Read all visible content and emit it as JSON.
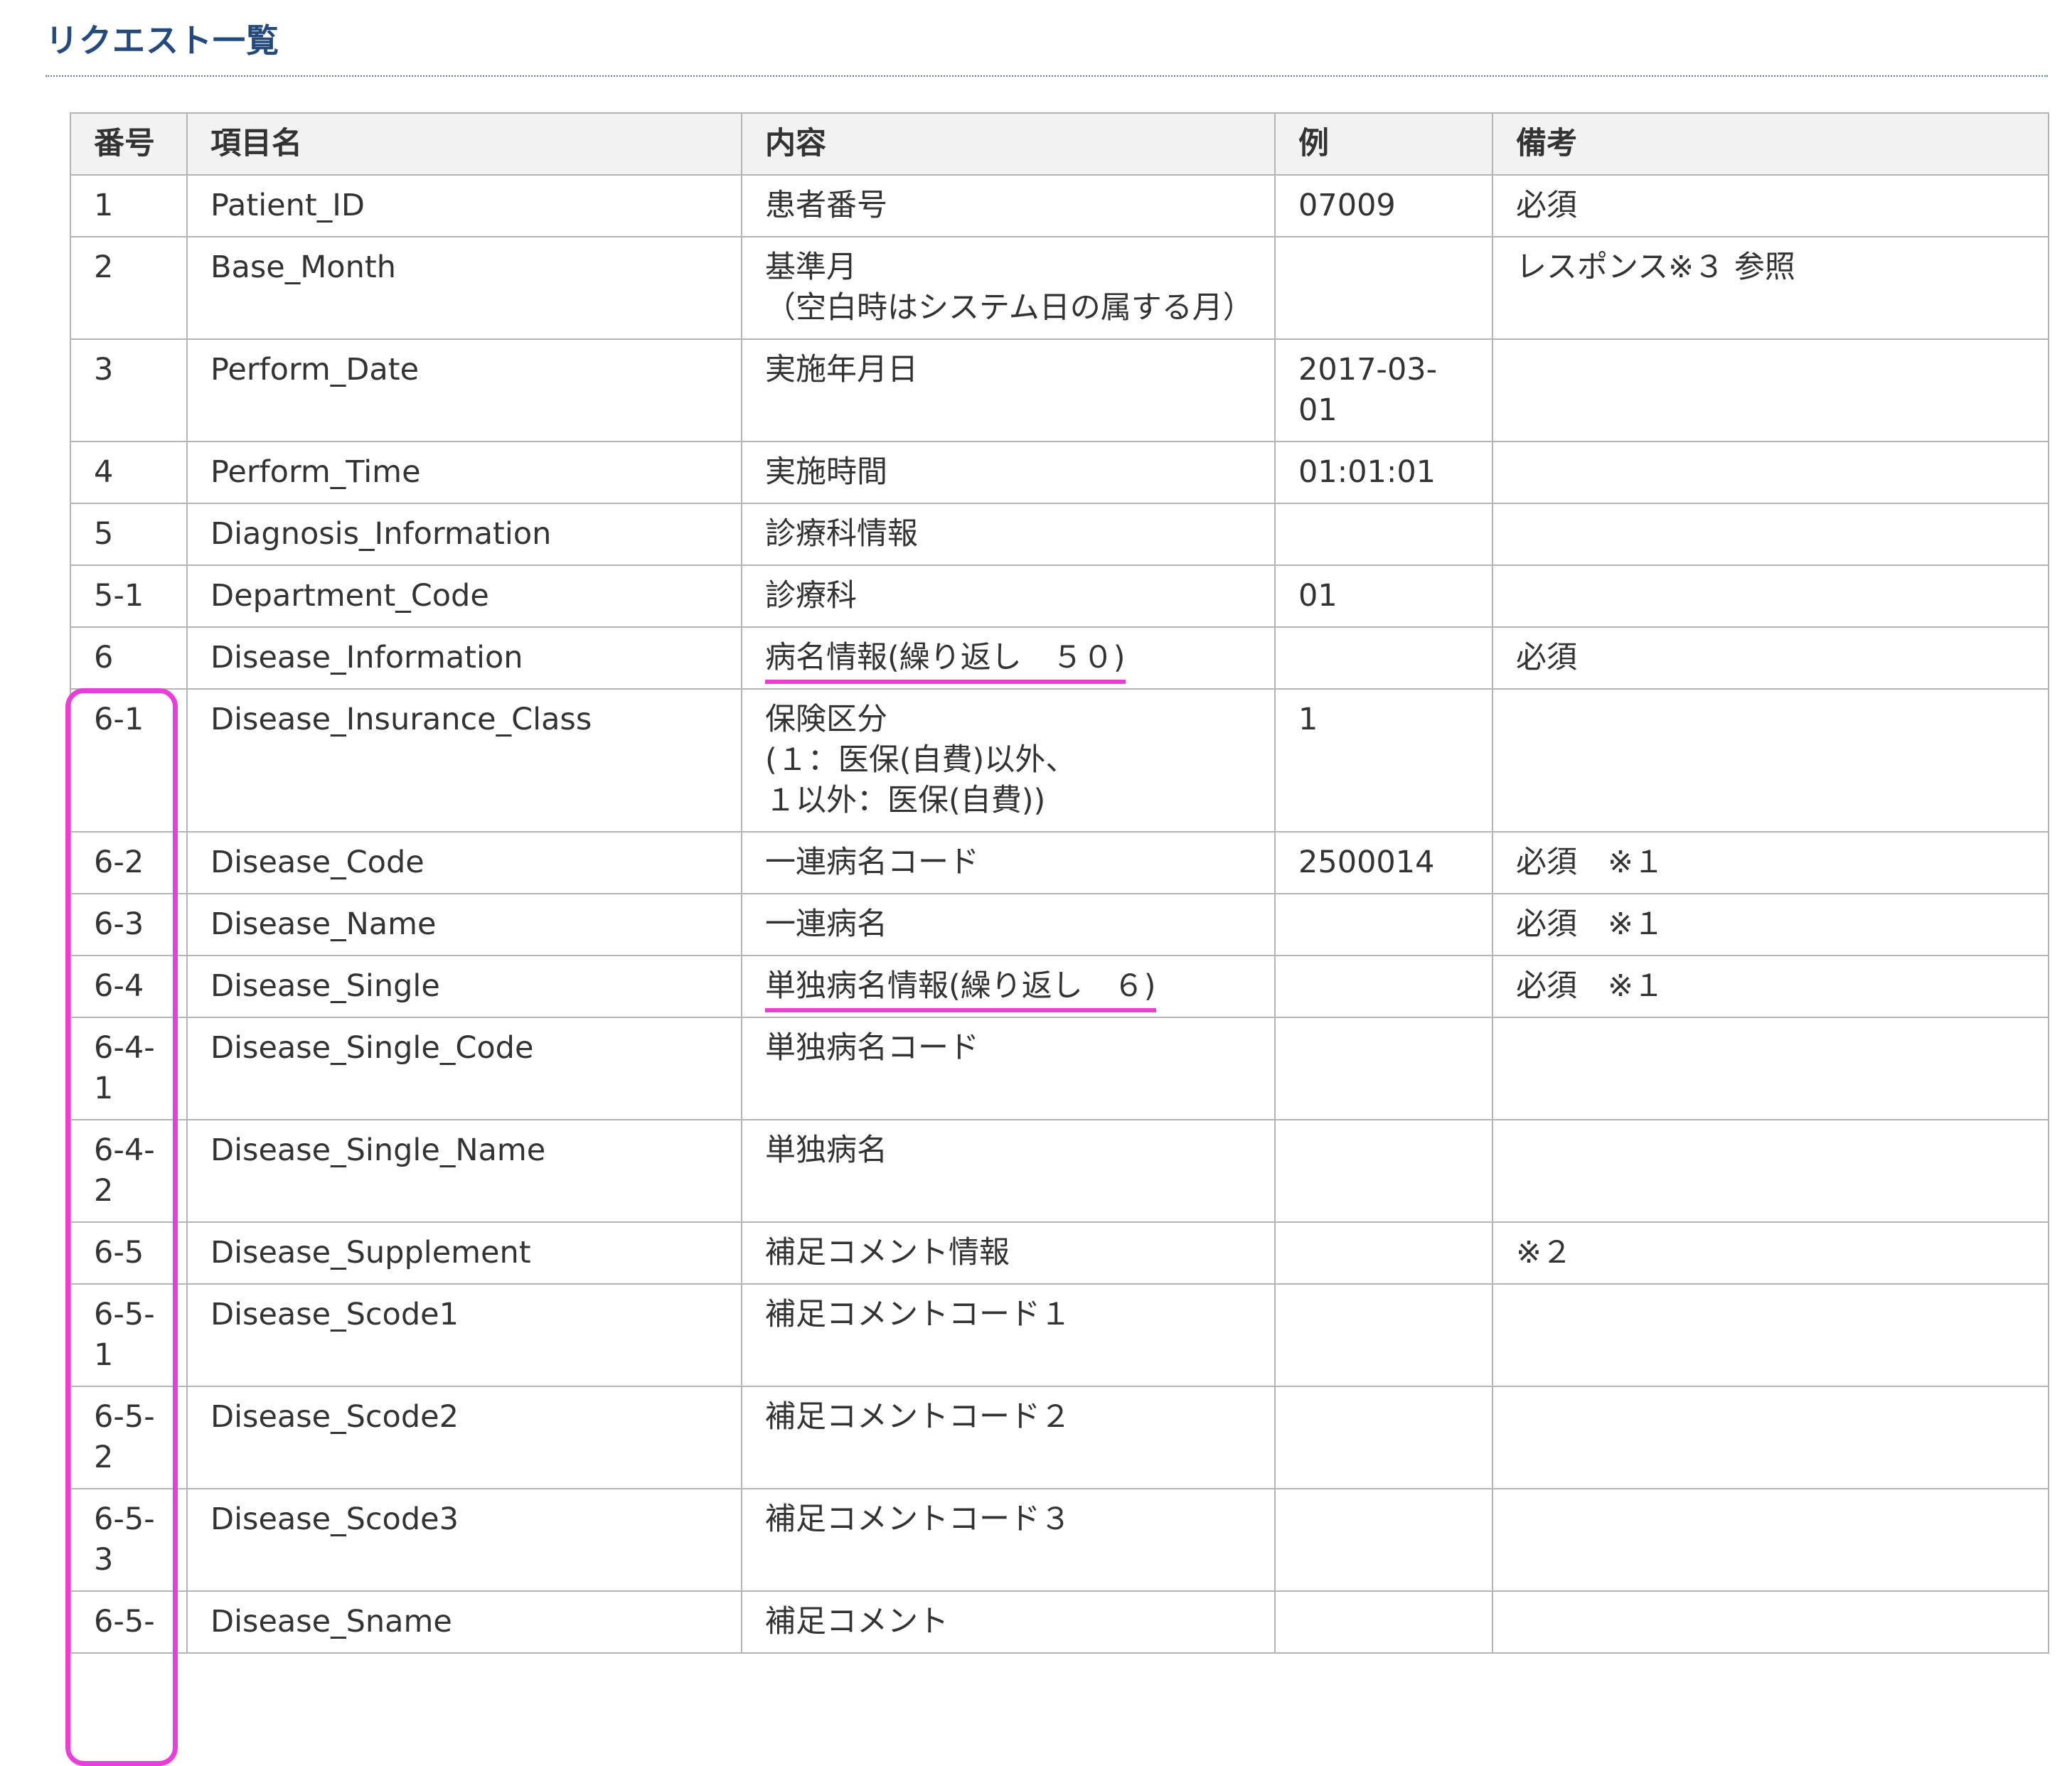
{
  "page": {
    "title": "リクエスト一覧"
  },
  "table": {
    "headers": {
      "no": "番号",
      "name": "項目名",
      "content": "内容",
      "example": "例",
      "note": "備考"
    },
    "rows": [
      {
        "no": "1",
        "name": "Patient_ID",
        "content": "患者番号",
        "example": "07009",
        "note": "必須"
      },
      {
        "no": "2",
        "name": "Base_Month",
        "content": "基準月\n（空白時はシステム日の属する月）",
        "example": "",
        "note": "レスポンス※３ 参照"
      },
      {
        "no": "3",
        "name": "Perform_Date",
        "content": "実施年月日",
        "example": "2017-03-01",
        "note": ""
      },
      {
        "no": "4",
        "name": "Perform_Time",
        "content": "実施時間",
        "example": "01:01:01",
        "note": ""
      },
      {
        "no": "5",
        "name": "Diagnosis_Information",
        "content": "診療科情報",
        "example": "",
        "note": ""
      },
      {
        "no": "5-1",
        "name": "Department_Code",
        "content": "診療科",
        "example": "01",
        "note": ""
      },
      {
        "no": "6",
        "name": "Disease_Information",
        "content": "病名情報(繰り返し　５０)",
        "example": "",
        "note": "必須",
        "underline": true
      },
      {
        "no": "6-1",
        "name": "Disease_Insurance_Class",
        "content": "保険区分\n(１：医保(自費)以外、\n１以外：医保(自費))",
        "example": "1",
        "note": ""
      },
      {
        "no": "6-2",
        "name": "Disease_Code",
        "content": "一連病名コード",
        "example": "2500014",
        "note": "必須　※１"
      },
      {
        "no": "6-3",
        "name": "Disease_Name",
        "content": "一連病名",
        "example": "",
        "note": "必須　※１"
      },
      {
        "no": "6-4",
        "name": "Disease_Single",
        "content": "単独病名情報(繰り返し　６)",
        "example": "",
        "note": "必須　※１",
        "underline": true
      },
      {
        "no": "6-4-1",
        "name": "Disease_Single_Code",
        "content": "単独病名コード",
        "example": "",
        "note": ""
      },
      {
        "no": "6-4-2",
        "name": "Disease_Single_Name",
        "content": "単独病名",
        "example": "",
        "note": ""
      },
      {
        "no": "6-5",
        "name": "Disease_Supplement",
        "content": "補足コメント情報",
        "example": "",
        "note": "※２"
      },
      {
        "no": "6-5-1",
        "name": "Disease_Scode1",
        "content": "補足コメントコード１",
        "example": "",
        "note": ""
      },
      {
        "no": "6-5-2",
        "name": "Disease_Scode2",
        "content": "補足コメントコード２",
        "example": "",
        "note": ""
      },
      {
        "no": "6-5-3",
        "name": "Disease_Scode3",
        "content": "補足コメントコード３",
        "example": "",
        "note": ""
      },
      {
        "no": "6-5-",
        "name": "Disease_Sname",
        "content": "補足コメント",
        "example": "",
        "note": ""
      }
    ]
  },
  "colors": {
    "title": "#234a7a",
    "highlight": "#e83fd8",
    "border": "#b5b5b5",
    "header_bg": "#f2f2f2"
  }
}
